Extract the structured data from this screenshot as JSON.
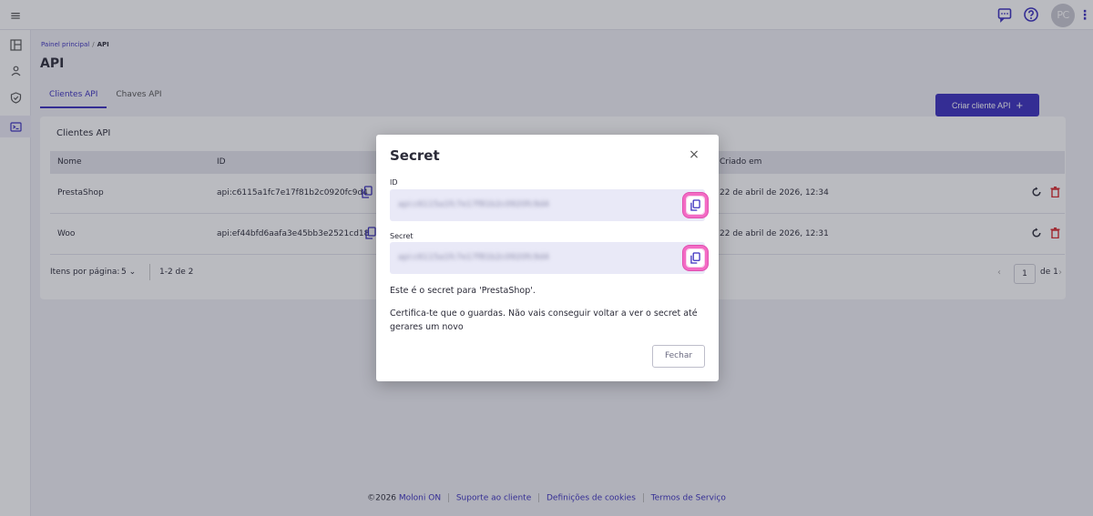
{
  "topbar": {
    "avatar_initials": "PC"
  },
  "breadcrumb": {
    "home": "Painel principal",
    "separator": "/",
    "current": "API"
  },
  "page": {
    "title": "API"
  },
  "tabs": [
    {
      "label": "Clientes API",
      "active": true
    },
    {
      "label": "Chaves API",
      "active": false
    }
  ],
  "card": {
    "title": "Clientes API",
    "create_button": "Criar cliente API",
    "create_icon": "+"
  },
  "table": {
    "columns": [
      "Nome",
      "ID",
      "Criado em"
    ],
    "rows": [
      {
        "name": "PrestaShop",
        "id": "api:c6115a1fc7e17f81b2c0920fc9d4",
        "created": "22 de abril de 2026, 12:34"
      },
      {
        "name": "Woo",
        "id": "api:ef44bfd6aafa3e45bb3e2521cd18",
        "created": "22 de abril de 2026, 12:31"
      }
    ]
  },
  "pagination": {
    "items_per_page_label": "Itens por página:",
    "items_per_page_value": "5",
    "range": "1-2 de 2",
    "page": "1",
    "total_pages": "de 1"
  },
  "footer": {
    "copyright": "©2026",
    "brand": "Moloni ON",
    "links": [
      "Suporte ao cliente",
      "Definições de cookies",
      "Termos de Serviço"
    ]
  },
  "modal": {
    "title": "Secret",
    "close_icon": "×",
    "id_label": "ID",
    "id_value": "api:c6115a1fc7e17f81b2c0920fc9d4",
    "secret_label": "Secret",
    "secret_value": "api:c6115a1fc7e17f81b2c0920fc9d4",
    "info_text": "Este é o secret para 'PrestaShop'.",
    "warning_text": "Certifica-te que o guardas. Não vais conseguir voltar a ver o secret até gerares um novo",
    "close_button": "Fechar"
  },
  "colors": {
    "accent": "#3a2fbf",
    "highlight": "#f36bc4",
    "danger": "#d9262a"
  }
}
